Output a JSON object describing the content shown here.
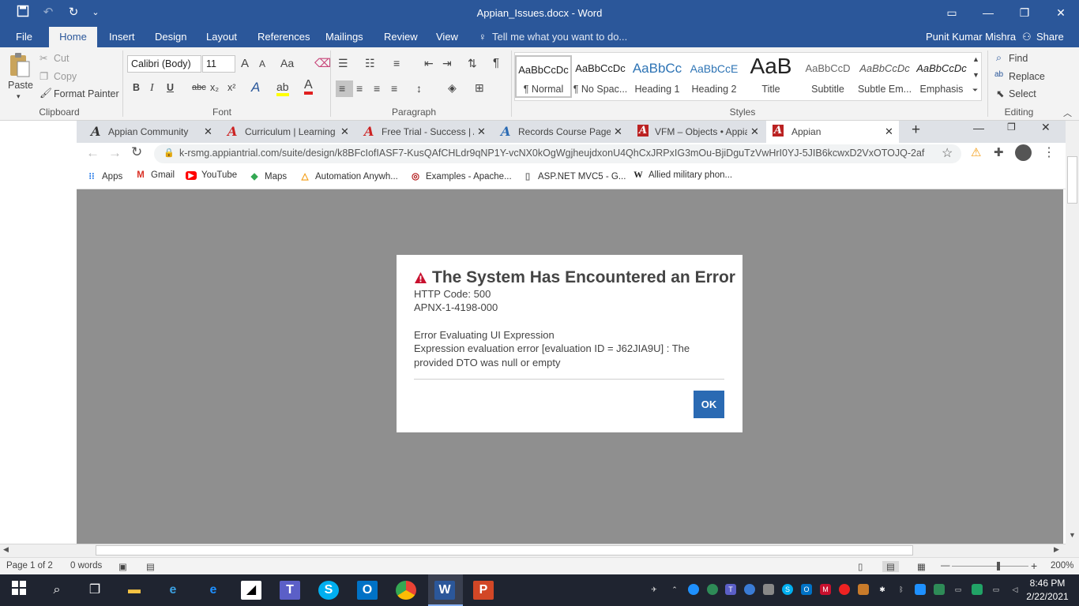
{
  "word": {
    "title": "Appian_Issues.docx - Word",
    "qa_more": "⌄",
    "window_controls": {
      "ribbon_display": "▭",
      "minimize": "—",
      "restore": "❐",
      "close": "✕"
    },
    "tabs": [
      "File",
      "Home",
      "Insert",
      "Design",
      "Layout",
      "References",
      "Mailings",
      "Review",
      "View"
    ],
    "tell_me": "Tell me what you want to do...",
    "user": "Punit Kumar Mishra",
    "share": "Share",
    "clipboard": {
      "paste": "Paste",
      "cut": "Cut",
      "copy": "Copy",
      "format_painter": "Format Painter",
      "group": "Clipboard"
    },
    "font": {
      "name": "Calibri (Body)",
      "size": "11",
      "grow": "A",
      "shrink": "A",
      "change_case": "Aa",
      "bold": "B",
      "italic": "I",
      "underline": "U",
      "strike": "abc",
      "subscript": "x₂",
      "superscript": "x²",
      "group": "Font"
    },
    "paragraph": {
      "group": "Paragraph",
      "pilcrow": "¶"
    },
    "styles": {
      "group": "Styles",
      "items": [
        {
          "sample": "AaBbCcDc",
          "name": "¶ Normal"
        },
        {
          "sample": "AaBbCcDc",
          "name": "¶ No Spac..."
        },
        {
          "sample": "AaBbCc",
          "name": "Heading 1"
        },
        {
          "sample": "AaBbCcE",
          "name": "Heading 2"
        },
        {
          "sample": "AaB",
          "name": "Title"
        },
        {
          "sample": "AaBbCcD",
          "name": "Subtitle"
        },
        {
          "sample": "AaBbCcDc",
          "name": "Subtle Em..."
        },
        {
          "sample": "AaBbCcDc",
          "name": "Emphasis"
        }
      ]
    },
    "editing": {
      "find": "Find",
      "replace": "Replace",
      "select": "Select",
      "group": "Editing"
    },
    "status": {
      "page": "Page 1 of 2",
      "words": "0 words",
      "zoom": "200%"
    }
  },
  "browser": {
    "tabs": [
      {
        "label": "Appian Community",
        "favicon": "A"
      },
      {
        "label": "Curriculum | Learning a",
        "favicon": "A"
      },
      {
        "label": "Free Trial - Success | Ap",
        "favicon": "A"
      },
      {
        "label": "Records Course Page -",
        "favicon": "A"
      },
      {
        "label": "VFM – Objects • Appian",
        "favicon": "A"
      },
      {
        "label": "Appian",
        "favicon": "A"
      }
    ],
    "new_tab": "+",
    "url": "k-rsmg.appiantrial.com/suite/design/k8BFcIofIASF7-KusQAfCHLdr9qNP1Y-vcNX0kOgWgjheujdxonU4QhCxJRPxIG3mOu-BjiDguTzVwHrI0YJ-5JIB6kcwxD2VxOTOJQ-2af",
    "bookmarks": [
      "Apps",
      "Gmail",
      "YouTube",
      "Maps",
      "Automation Anywh...",
      "Examples - Apache...",
      "ASP.NET MVC5 - G...",
      "Allied military phon..."
    ]
  },
  "dialog": {
    "title": "The System Has Encountered an Error",
    "http_code": "HTTP Code: 500",
    "apnx": "APNX-1-4198-000",
    "error_heading": "Error Evaluating UI Expression",
    "error_line1": "Expression evaluation error [evaluation ID = J62JIA9U] : The",
    "error_line2": "provided DTO was null or empty",
    "ok": "OK"
  },
  "taskbar": {
    "time": "8:46 PM",
    "date": "2/22/2021"
  }
}
